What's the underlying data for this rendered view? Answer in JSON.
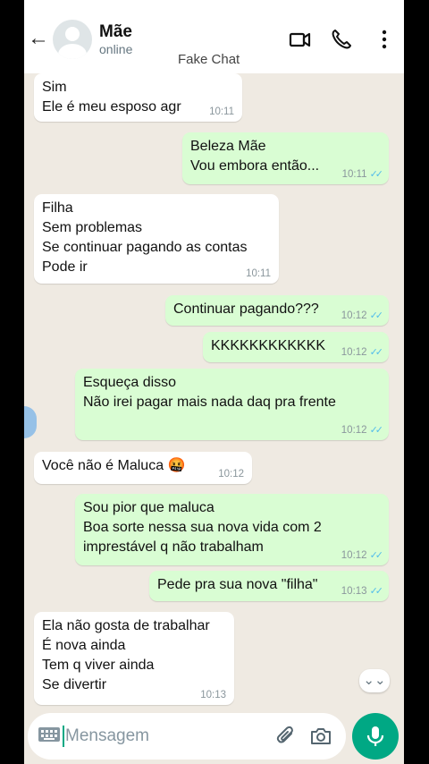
{
  "header": {
    "back_label": "←",
    "contact_name": "Mãe",
    "status": "online",
    "watermark": "Fake Chat"
  },
  "messages": [
    {
      "direction": "in",
      "text": "Sim\nEle é meu esposo agr",
      "time": "10:11",
      "ticks": ""
    },
    {
      "direction": "out",
      "text": "Beleza Mãe\nVou embora então...",
      "time": "10:11",
      "ticks": "✓✓"
    },
    {
      "direction": "in",
      "text": "Filha\nSem problemas\nSe continuar pagando as contas\nPode ir",
      "time": "10:11",
      "ticks": ""
    },
    {
      "direction": "out",
      "text": "Continuar pagando???",
      "time": "10:12",
      "ticks": "✓✓"
    },
    {
      "direction": "out",
      "text": "KKKKKKKKKKKK",
      "time": "10:12",
      "ticks": "✓✓"
    },
    {
      "direction": "out",
      "text": "Esqueça disso\nNão irei pagar mais nada daq pra frente",
      "time": "10:12",
      "ticks": "✓✓"
    },
    {
      "direction": "in",
      "text": "Você não é Maluca 🤬",
      "time": "10:12",
      "ticks": ""
    },
    {
      "direction": "out",
      "text": "Sou pior que maluca\nBoa sorte nessa sua nova vida com 2\nimprestável q não trabalham",
      "time": "10:12",
      "ticks": "✓✓"
    },
    {
      "direction": "out",
      "text": "Pede pra sua nova \"filha\"",
      "time": "10:13",
      "ticks": "✓✓"
    },
    {
      "direction": "in",
      "text": "Ela não gosta de trabalhar\nÉ nova ainda\nTem q viver ainda\nSe divertir",
      "time": "10:13",
      "ticks": ""
    }
  ],
  "composer": {
    "placeholder": "Mensagem"
  },
  "scroll_button_glyph": "⌄⌄",
  "colors": {
    "outgoing_bubble": "#d9fdd3",
    "incoming_bubble": "#ffffff",
    "chat_background": "#efeae2",
    "accent": "#00a884",
    "read_ticks": "#53bdeb"
  }
}
